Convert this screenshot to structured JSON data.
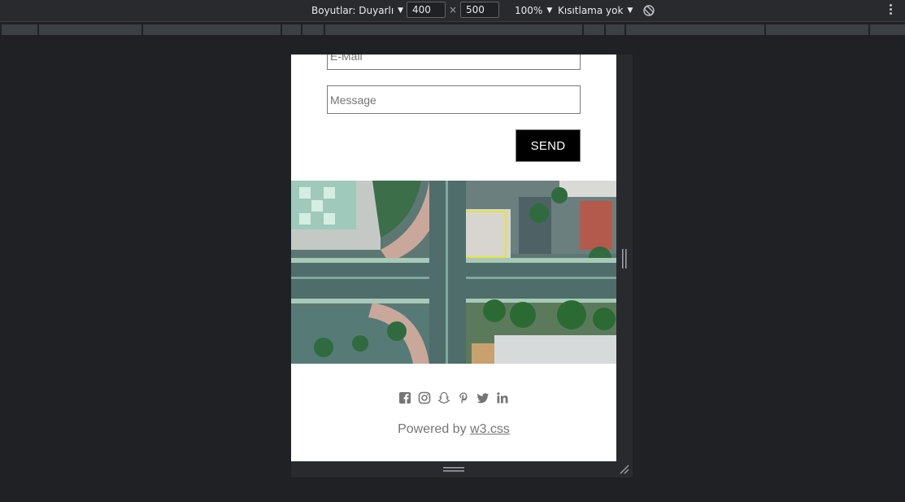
{
  "toolbar": {
    "dimensions_label": "Boyutlar: Duyarlı",
    "width_value": "400",
    "times_sign": "×",
    "height_value": "500",
    "zoom": "100%",
    "throttle": "Kısıtlama yok",
    "rotate_icon": "rotate-icon",
    "more_icon": "more-vert-icon"
  },
  "page": {
    "email_placeholder": "E-Mail",
    "message_placeholder": "Message",
    "send_label": "SEND",
    "social_icons": [
      "facebook-icon",
      "instagram-icon",
      "snapchat-icon",
      "pinterest-icon",
      "twitter-icon",
      "linkedin-icon"
    ],
    "powered_prefix": "Powered by ",
    "powered_link": "w3.css"
  },
  "colors": {
    "devtools_bg": "#202124",
    "toolbar_bg": "#292a2d",
    "button_bg": "#000000",
    "footer_text": "#757575"
  }
}
